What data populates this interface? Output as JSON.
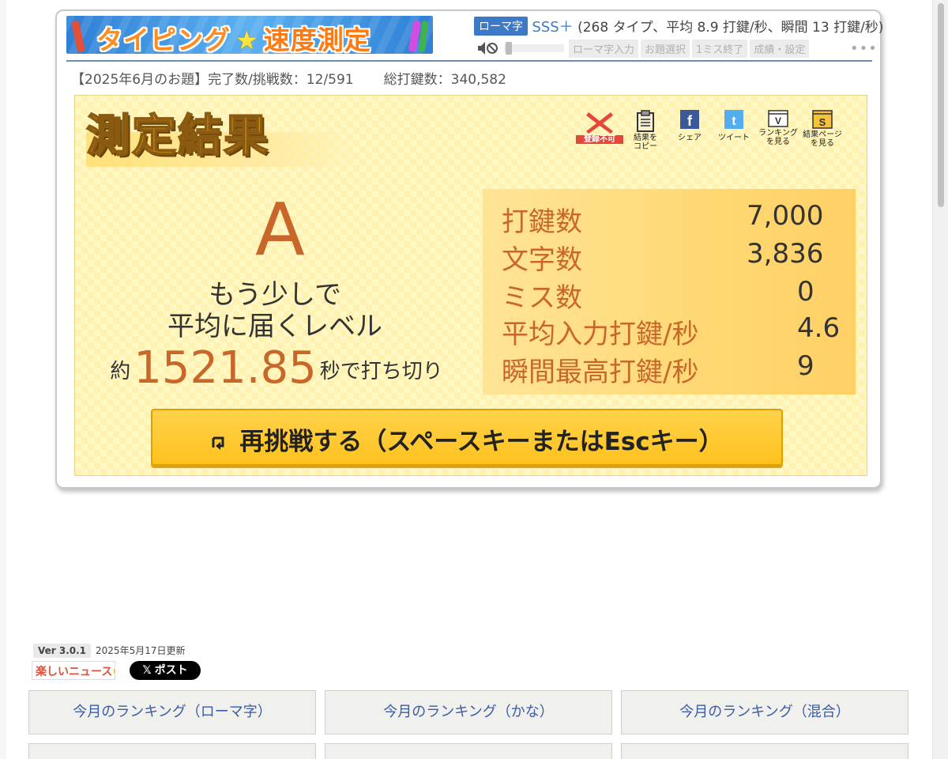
{
  "colors": {
    "accent": "#c9672b",
    "brand_blue": "#3c79c6",
    "button_yellow": "#ffc21f"
  },
  "header": {
    "banner_part1": "タイピング",
    "banner_part2": "速度測定",
    "mode_badge": "ローマ字",
    "rank": "SSS＋",
    "rank_detail": "(268 タイプ、平均 8.9 打鍵/秒、瞬間 13 打鍵/秒)",
    "tools": [
      "ローマ字入力",
      "お題選択",
      "1ミス終了",
      "成績・設定"
    ],
    "more": "•••"
  },
  "stats": {
    "monthly": "【2025年6月のお題】完了数/挑戦数：12/591",
    "total": "総打鍵数：340,582"
  },
  "result": {
    "title": "測定結果",
    "actions": [
      {
        "label": "登録不可",
        "icon": "cross-icon"
      },
      {
        "label": "結果を\nコピー",
        "icon": "clipboard-icon"
      },
      {
        "label": "シェア",
        "icon": "facebook-icon"
      },
      {
        "label": "ツイート",
        "icon": "twitter-icon"
      },
      {
        "label": "ランキング\nを見る",
        "icon": "ranking-icon"
      },
      {
        "label": "結果ページ\nを見る",
        "icon": "result-page-icon"
      }
    ],
    "grade": "A",
    "comment_line1": "もう少しで",
    "comment_line2": "平均に届くレベル",
    "finish_pre": "約",
    "finish_time": "1521.85",
    "finish_post": "秒で打ち切り",
    "rows": [
      {
        "label": "打鍵数",
        "value": "7,000"
      },
      {
        "label": "文字数",
        "value": "3,836"
      },
      {
        "label": "ミス数",
        "value": "0"
      },
      {
        "label": "平均入力打鍵/秒",
        "value": "4.6"
      },
      {
        "label": "瞬間最高打鍵/秒",
        "value": "9"
      }
    ],
    "retry_label": "再挑戦する（スペースキーまたはEscキー）"
  },
  "footer": {
    "version": "Ver 3.0.1",
    "updated": "2025年5月17日更新",
    "news_logo": "楽しいニュース",
    "post": "ポスト",
    "ranking_buttons": [
      "今月のランキング（ローマ字）",
      "今月のランキング（かな）",
      "今月のランキング（混合）"
    ]
  }
}
